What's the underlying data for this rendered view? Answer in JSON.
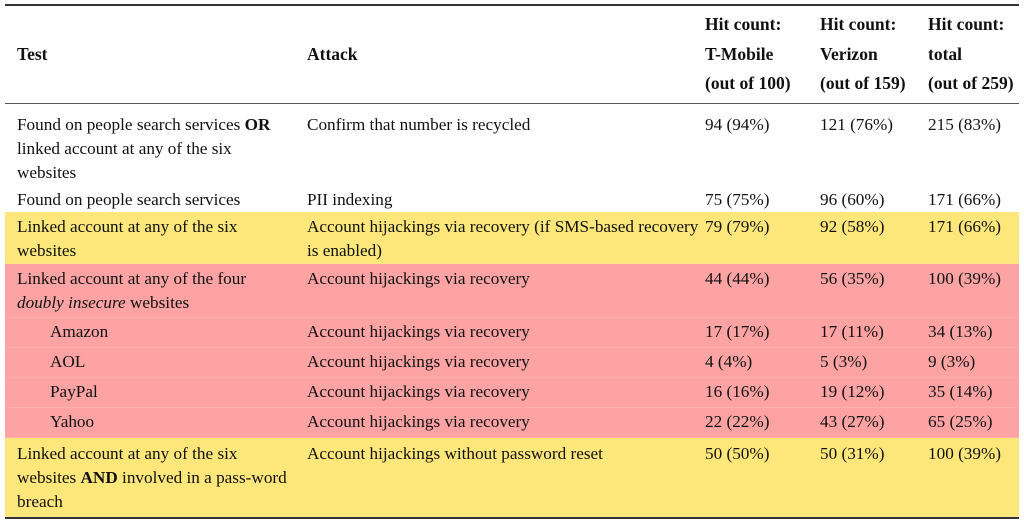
{
  "table": {
    "colors": {
      "yellow_highlight": "#fde67a",
      "red_highlight": "#fda3a3"
    },
    "headers": {
      "test": "Test",
      "attack": "Attack",
      "tmobile": [
        "Hit count:",
        "T-Mobile",
        "(out of 100)"
      ],
      "verizon": [
        "Hit count:",
        "Verizon",
        "(out of 159)"
      ],
      "total": [
        "Hit count:",
        "total",
        "(out of 259)"
      ]
    },
    "rows": [
      {
        "highlight": "none",
        "test_parts": [
          "Found on people search services ",
          "OR",
          " linked account at any of the six websites"
        ],
        "attack": "Confirm that number is recycled",
        "tmobile": "94 (94%)",
        "verizon": "121 (76%)",
        "total": "215 (83%)"
      },
      {
        "highlight": "none",
        "test": "Found on people search services",
        "attack": "PII indexing",
        "tmobile": "75 (75%)",
        "verizon": "96 (60%)",
        "total": "171 (66%)"
      },
      {
        "highlight": "yellow",
        "test": "Linked account at any of the six websites",
        "attack": "Account hijackings via recovery (if SMS-based recovery is enabled)",
        "tmobile": "79 (79%)",
        "verizon": "92 (58%)",
        "total": "171 (66%)"
      },
      {
        "highlight": "red",
        "test_parts": [
          "Linked account at any of the four ",
          "doubly insecure",
          " websites"
        ],
        "attack": "Account hijackings via recovery",
        "tmobile": "44 (44%)",
        "verizon": "56 (35%)",
        "total": "100 (39%)"
      },
      {
        "highlight": "red",
        "test": "Amazon",
        "attack": "Account hijackings via recovery",
        "tmobile": "17 (17%)",
        "verizon": "17 (11%)",
        "total": "34 (13%)"
      },
      {
        "highlight": "red",
        "test": "AOL",
        "attack": "Account hijackings via recovery",
        "tmobile": "4 (4%)",
        "verizon": "5 (3%)",
        "total": "9 (3%)"
      },
      {
        "highlight": "red",
        "test": "PayPal",
        "attack": "Account hijackings via recovery",
        "tmobile": "16 (16%)",
        "verizon": "19 (12%)",
        "total": "35 (14%)"
      },
      {
        "highlight": "red",
        "test": "Yahoo",
        "attack": "Account hijackings via recovery",
        "tmobile": "22 (22%)",
        "verizon": "43 (27%)",
        "total": "65 (25%)"
      },
      {
        "highlight": "yellow",
        "test_parts": [
          "Linked account at any of the six websites ",
          "AND",
          " involved in a pass-word breach"
        ],
        "attack": "Account hijackings without password reset",
        "tmobile": "50 (50%)",
        "verizon": "50 (31%)",
        "total": "100 (39%)"
      }
    ]
  }
}
